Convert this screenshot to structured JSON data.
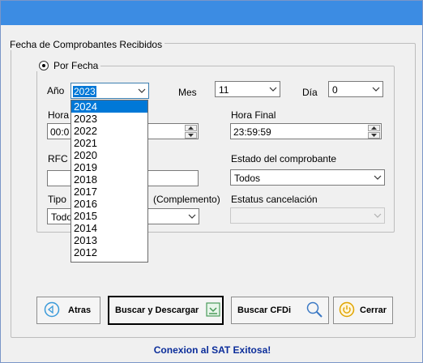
{
  "group": {
    "title": "Fecha de Comprobantes Recibidos"
  },
  "por_fecha": {
    "label": "Por Fecha"
  },
  "ano": {
    "label": "Año",
    "value": "2023"
  },
  "mes": {
    "label": "Mes",
    "value": "11"
  },
  "dia": {
    "label": "Día",
    "value": "0"
  },
  "hora_inicial": {
    "label": "Hora",
    "value": "00:0"
  },
  "hora_final": {
    "label": "Hora Final",
    "value": "23:59:59"
  },
  "rfc": {
    "label": "RFC",
    "value": ""
  },
  "estado": {
    "label": "Estado del comprobante",
    "value": "Todos"
  },
  "tipo": {
    "label": "Tipo",
    "label_suffix": "(Complemento)",
    "value": "Todo"
  },
  "estatus_cancelacion": {
    "label": "Estatus cancelación",
    "value": ""
  },
  "year_dropdown": {
    "options": [
      "2024",
      "2023",
      "2022",
      "2021",
      "2020",
      "2019",
      "2018",
      "2017",
      "2016",
      "2015",
      "2014",
      "2013",
      "2012"
    ],
    "highlighted": "2024"
  },
  "buttons": {
    "atras": "Atras",
    "buscar_descargar": "Buscar y Descargar",
    "buscar_cfdi": "Buscar CFDi",
    "cerrar": "Cerrar"
  },
  "status_text": "Conexion al SAT Exitosa!",
  "colors": {
    "titlebar": "#3c8ce3",
    "status": "#0b2d9a",
    "highlight": "#0078d7"
  }
}
